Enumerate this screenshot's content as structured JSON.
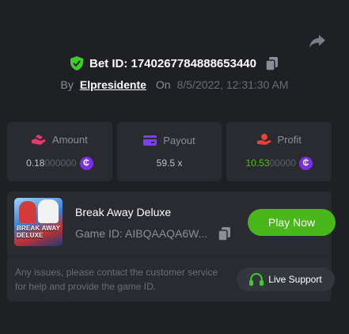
{
  "bet": {
    "id_text": "Bet ID: 1740267784888653440",
    "by_label": "By",
    "username": "Elpresidente",
    "on_label": "On",
    "datetime": "8/5/2022, 12:31:30 AM"
  },
  "stats": {
    "amount": {
      "label": "Amount",
      "value_main": "0.18",
      "value_dim": "000000"
    },
    "payout": {
      "label": "Payout",
      "value": "59.5 x"
    },
    "profit": {
      "label": "Profit",
      "value_main": "10.53",
      "value_dim": "00000"
    }
  },
  "game": {
    "title": "Break Away Deluxe",
    "id_text": "Game ID: AIBQAAQA6W...",
    "thumb_text_line1": "BREAK AWAY",
    "thumb_text_line2": "DELUXE",
    "play_label": "Play Now"
  },
  "support": {
    "text": "Any issues, please contact the customer service for help and provide the game ID.",
    "button_label": "Live Support"
  },
  "icons": {
    "share": "share-icon",
    "shield": "shield-check-icon",
    "copy": "copy-icon",
    "amount": "hand-coins-icon",
    "payout": "card-icon",
    "profit": "hand-gift-icon",
    "coin": "crypto-coin-icon",
    "headset": "headset-icon"
  },
  "colors": {
    "background": "#1f2024",
    "card": "#2a2b31",
    "accent_green": "#49b71a",
    "coin_purple": "#7a2fe0",
    "amount_icon": "#e8396b",
    "payout_icon": "#7b3ff2",
    "profit_icon": "#e8443a"
  }
}
